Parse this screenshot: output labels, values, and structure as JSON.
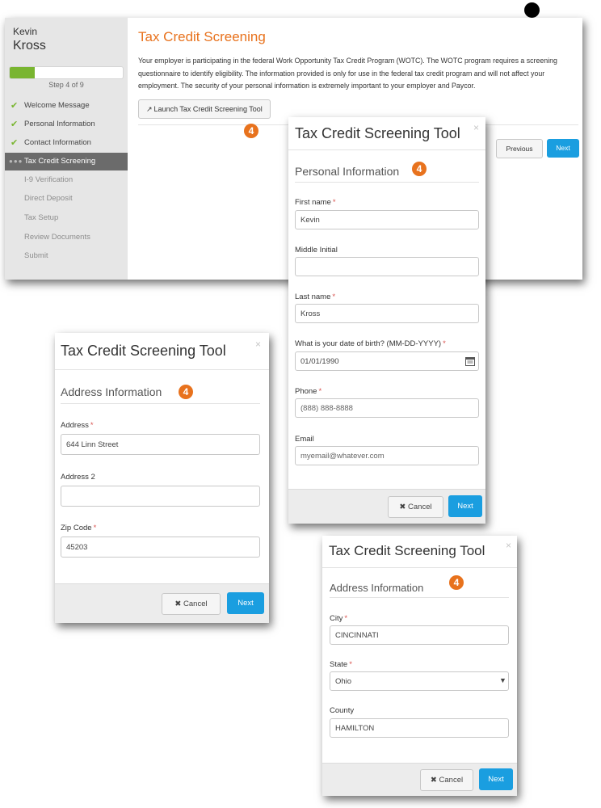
{
  "user": {
    "first_name": "Kevin",
    "last_name": "Kross"
  },
  "progress": {
    "percent": 22,
    "step_text": "Step 4 of 9"
  },
  "nav": [
    {
      "label": "Welcome Message",
      "state": "done"
    },
    {
      "label": "Personal Information",
      "state": "done"
    },
    {
      "label": "Contact Information",
      "state": "done"
    },
    {
      "label": "Tax Credit Screening",
      "state": "active"
    },
    {
      "label": "I-9 Verification",
      "state": "pending"
    },
    {
      "label": "Direct Deposit",
      "state": "pending"
    },
    {
      "label": "Tax Setup",
      "state": "pending"
    },
    {
      "label": "Review Documents",
      "state": "pending"
    },
    {
      "label": "Submit",
      "state": "pending"
    }
  ],
  "main": {
    "title": "Tax Credit Screening",
    "intro": "Your employer is participating in the federal Work Opportunity Tax Credit Program (WOTC). The WOTC program requires a screening questionnaire to identify eligibility. The information provided is only for use in the federal tax credit program and will not affect your employment. The security of your personal information is extremely important to your employer and Paycor.",
    "launch_label": "Launch Tax Credit Screening Tool",
    "previous_label": "Previous",
    "next_label": "Next"
  },
  "badge_text": "4",
  "close_glyph": "×",
  "dialog_personal": {
    "title": "Tax Credit Screening Tool",
    "section": "Personal Information",
    "first_name_label": "First name",
    "first_name_value": "Kevin",
    "middle_initial_label": "Middle Initial",
    "middle_initial_value": "",
    "last_name_label": "Last name",
    "last_name_value": "Kross",
    "dob_label": "What is your date of birth?  (MM-DD-YYYY)",
    "dob_value": "01/01/1990",
    "phone_label": "Phone",
    "phone_placeholder": "(888) 888-8888",
    "email_label": "Email",
    "email_placeholder": "myemail@whatever.com",
    "cancel_label": "Cancel",
    "next_label": "Next"
  },
  "dialog_address1": {
    "title": "Tax Credit Screening Tool",
    "section": "Address Information",
    "address_label": "Address",
    "address_value": "644 Linn Street",
    "address2_label": "Address 2",
    "address2_value": "",
    "zip_label": "Zip Code",
    "zip_value": "45203",
    "cancel_label": "Cancel",
    "next_label": "Next"
  },
  "dialog_address2": {
    "title": "Tax Credit Screening Tool",
    "section": "Address Information",
    "city_label": "City",
    "city_value": "CINCINNATI",
    "state_label": "State",
    "state_value": "Ohio",
    "county_label": "County",
    "county_value": "HAMILTON",
    "cancel_label": "Cancel",
    "next_label": "Next"
  },
  "colors": {
    "accent_orange": "#e8721d",
    "primary_blue": "#1a9ee0",
    "progress_green": "#79b530",
    "required_red": "#d9534f"
  },
  "icons": {
    "done": "checkmark-icon",
    "launch": "share-icon",
    "calendar": "calendar-icon",
    "cancel": "x-icon",
    "select": "caret-down-icon"
  }
}
